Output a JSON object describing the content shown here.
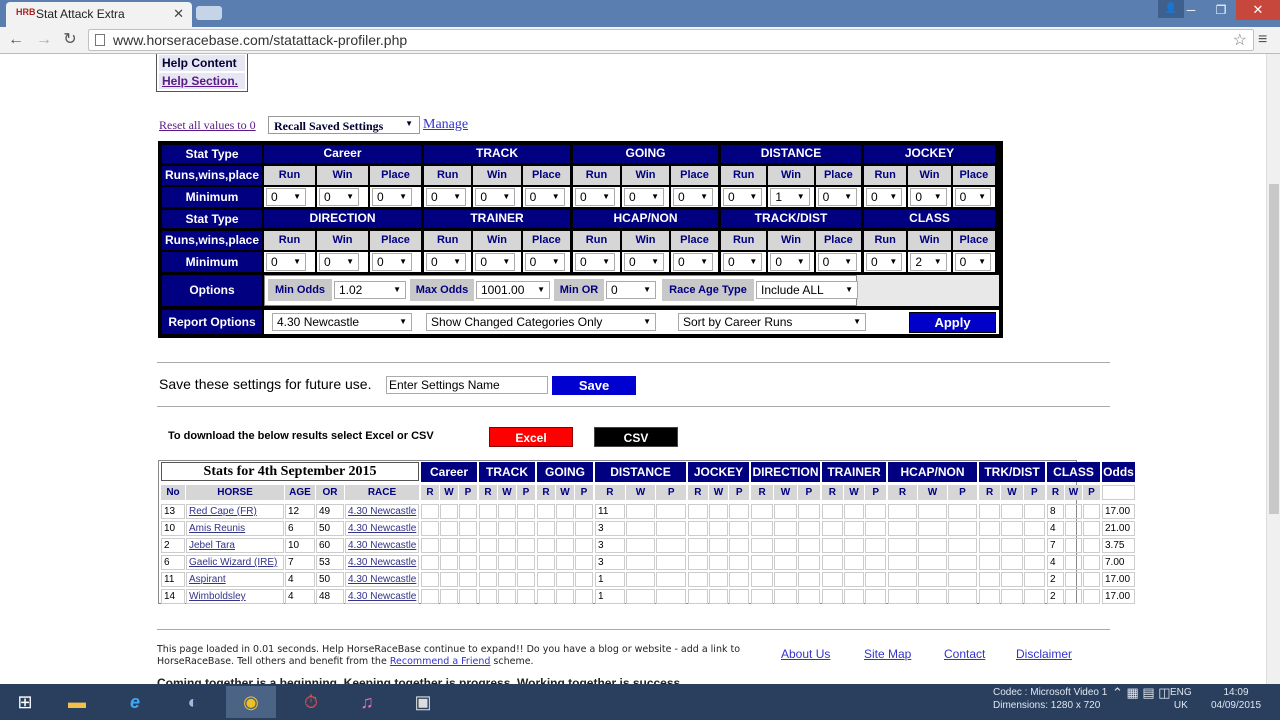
{
  "browser": {
    "tab_title": "Stat Attack Extra",
    "tab_icon": "HRB",
    "url": "www.horseracebase.com/statattack-profiler.php"
  },
  "help": {
    "content": "Help Content",
    "section": "Help Section."
  },
  "settings_bar": {
    "reset": "Reset all values to 0",
    "recall": "Recall Saved Settings",
    "manage": "Manage"
  },
  "settings": {
    "row_labels": {
      "stat_type": "Stat Type",
      "runs": "Runs,wins,place",
      "minimum": "Minimum",
      "options": "Options",
      "report_options": "Report Options"
    },
    "sub_labels": [
      "Run",
      "Win",
      "Place"
    ],
    "groups1": [
      {
        "name": "Career",
        "values": [
          "0",
          "0",
          "0"
        ]
      },
      {
        "name": "TRACK",
        "values": [
          "0",
          "0",
          "0"
        ]
      },
      {
        "name": "GOING",
        "values": [
          "0",
          "0",
          "0"
        ]
      },
      {
        "name": "DISTANCE",
        "values": [
          "0",
          "1",
          "0"
        ]
      },
      {
        "name": "JOCKEY",
        "values": [
          "0",
          "0",
          "0"
        ]
      }
    ],
    "groups2": [
      {
        "name": "DIRECTION",
        "values": [
          "0",
          "0",
          "0"
        ]
      },
      {
        "name": "TRAINER",
        "values": [
          "0",
          "0",
          "0"
        ]
      },
      {
        "name": "HCAP/NON",
        "values": [
          "0",
          "0",
          "0"
        ]
      },
      {
        "name": "TRACK/DIST",
        "values": [
          "0",
          "0",
          "0"
        ]
      },
      {
        "name": "CLASS",
        "values": [
          "0",
          "2",
          "0"
        ]
      }
    ],
    "options": {
      "min_odds_label": "Min Odds",
      "min_odds": "1.02",
      "max_odds_label": "Max Odds",
      "max_odds": "1001.00",
      "min_or_label": "Min OR",
      "min_or": "0",
      "race_age_label": "Race Age Type",
      "race_age": "Include ALL"
    },
    "report": {
      "race": "4.30 Newcastle",
      "show": "Show Changed Categories Only",
      "sort": "Sort by Career Runs",
      "apply": "Apply"
    }
  },
  "save": {
    "text": "Save these settings for future use.",
    "input_value": "Enter Settings Name",
    "button": "Save"
  },
  "download": {
    "text": "To download the below results select Excel or CSV",
    "excel": "Excel",
    "csv": "CSV"
  },
  "results": {
    "title": "Stats for 4th September 2015",
    "groups": [
      "Career",
      "TRACK",
      "GOING",
      "DISTANCE",
      "JOCKEY",
      "DIRECTION",
      "TRAINER",
      "HCAP/NON",
      "TRK/DIST",
      "CLASS",
      "Odds"
    ],
    "columns": [
      "No",
      "HORSE",
      "AGE",
      "OR",
      "RACE"
    ],
    "rwp": [
      "R",
      "W",
      "P"
    ],
    "rows": [
      {
        "no": "13",
        "horse": "Red Cape (FR)",
        "age": "12",
        "or": "49",
        "race": "4.30 Newcastle",
        "dist_r": "11",
        "class_r": "8",
        "odds": "17.00"
      },
      {
        "no": "10",
        "horse": "Amis Reunis",
        "age": "6",
        "or": "50",
        "race": "4.30 Newcastle",
        "dist_r": "3",
        "class_r": "4",
        "odds": "21.00"
      },
      {
        "no": "2",
        "horse": "Jebel Tara",
        "age": "10",
        "or": "60",
        "race": "4.30 Newcastle",
        "dist_r": "3",
        "class_r": "7",
        "odds": "3.75"
      },
      {
        "no": "6",
        "horse": "Gaelic Wizard (IRE)",
        "age": "7",
        "or": "53",
        "race": "4.30 Newcastle",
        "dist_r": "3",
        "class_r": "4",
        "odds": "7.00"
      },
      {
        "no": "11",
        "horse": "Aspirant",
        "age": "4",
        "or": "50",
        "race": "4.30 Newcastle",
        "dist_r": "1",
        "class_r": "2",
        "odds": "17.00"
      },
      {
        "no": "14",
        "horse": "Wimboldsley",
        "age": "4",
        "or": "48",
        "race": "4.30 Newcastle",
        "dist_r": "1",
        "class_r": "2",
        "odds": "17.00"
      }
    ]
  },
  "footer": {
    "text1": "This page loaded in 0.01 seconds. Help HorseRaceBase continue to expand!! Do you have a blog or website - add a link to HorseRaceBase. Tell others and benefit from the",
    "recommend": "Recommend a Friend",
    "text2": "scheme.",
    "links": [
      "About Us",
      "Site Map",
      "Contact",
      "Disclaimer"
    ],
    "motto": "Coming together is a beginning. Keeping together is progress. Working together is success."
  },
  "taskbar": {
    "video_line1": "Codec : Microsoft Video 1",
    "video_line2": "Dimensions: 1280 x 720",
    "lang1": "ENG",
    "lang2": "UK",
    "time": "14:09",
    "date": "04/09/2015"
  }
}
